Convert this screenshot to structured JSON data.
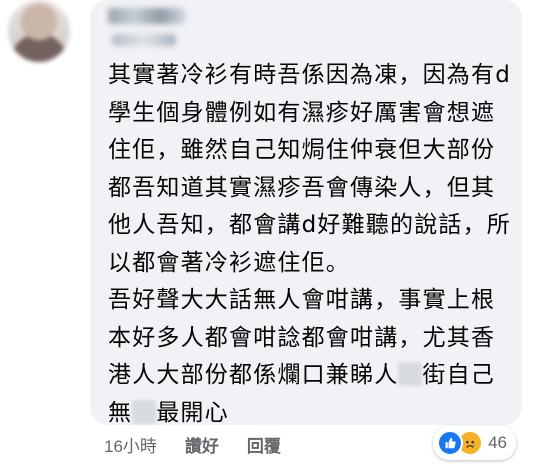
{
  "comment": {
    "lines": [
      "其實著冷衫有時吾係因為凍，因為有d",
      "學生個身體例如有濕疹好厲害會想遮",
      "住佢，雖然自己知焗住仲衰但大部份",
      "都吾知道其實濕疹吾會傳染人，但其",
      "他人吾知，都會講d好難聽的說話，所",
      "以都會著冷衫遮住佢。",
      "吾好聲大大話無人會咁講，事實上根",
      "本好多人都會咁諗都會咁講，尤其香"
    ],
    "line9_before": "港人大部份都係爛口兼睇人",
    "line9_after": "街自己",
    "line10_before": "無",
    "line10_after": "最開心"
  },
  "actions": {
    "time": "16小時",
    "like": "讚好",
    "reply": "回覆"
  },
  "reactions": {
    "icons": [
      "like-icon",
      "sad-icon"
    ],
    "count": "46"
  },
  "colors": {
    "bubble": "#f0f2f5",
    "text": "#050505",
    "meta": "#65676b",
    "like_blue": "#1877f2",
    "sad_yellow": "#f7b125"
  }
}
